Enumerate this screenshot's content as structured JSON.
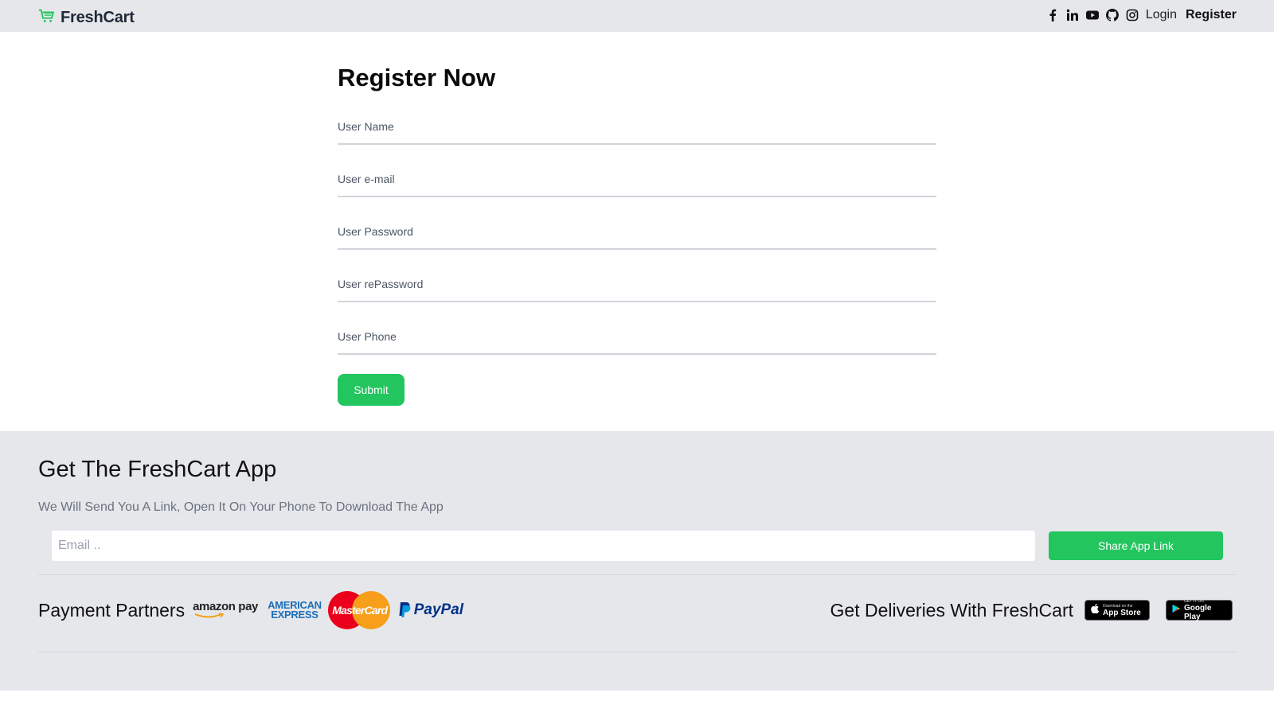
{
  "brand": {
    "name": "FreshCart",
    "icon": "cart-icon",
    "accent": "#22c55e"
  },
  "nav": {
    "social_icons": [
      "facebook-icon",
      "linkedin-icon",
      "youtube-icon",
      "github-icon",
      "instagram-icon"
    ],
    "login": "Login",
    "register": "Register"
  },
  "form": {
    "title": "Register Now",
    "fields": [
      {
        "name": "username",
        "placeholder": "User Name",
        "value": ""
      },
      {
        "name": "email",
        "placeholder": "User e-mail",
        "value": ""
      },
      {
        "name": "password",
        "placeholder": "User Password",
        "value": ""
      },
      {
        "name": "repassword",
        "placeholder": "User rePassword",
        "value": ""
      },
      {
        "name": "phone",
        "placeholder": "User Phone",
        "value": ""
      }
    ],
    "submit_label": "Submit"
  },
  "footer": {
    "app_title": "Get The FreshCart App",
    "app_subtitle": "We Will Send You A Link, Open It On Your Phone To Download The App",
    "email_placeholder": "Email ..",
    "share_label": "Share App Link",
    "payment_label": "Payment Partners",
    "payment_logos": {
      "amazon": "amazon pay",
      "amex_line1": "AMERICAN",
      "amex_line2": "EXPRESS",
      "mastercard": "MasterCard",
      "paypal": "PayPal"
    },
    "deliveries_label": "Get Deliveries With FreshCart",
    "app_store": {
      "small": "Download on the",
      "big": "App Store"
    },
    "google_play": {
      "small": "GET IT ON",
      "big": "Google Play"
    }
  },
  "colors": {
    "navbar_bg": "#e5e7eb",
    "footer_bg": "#e5e7eb",
    "button_green": "#22c55e"
  }
}
